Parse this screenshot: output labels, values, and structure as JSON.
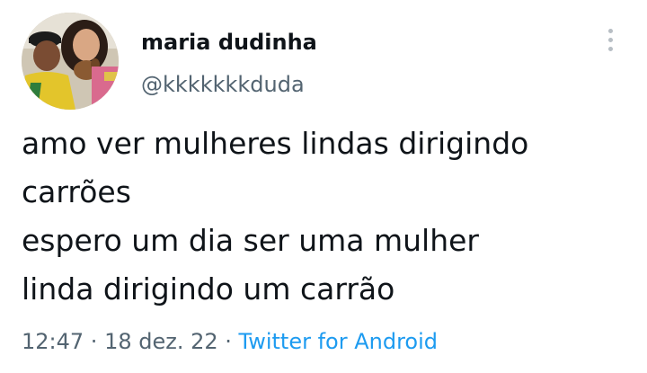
{
  "user": {
    "display_name": "maria dudinha",
    "handle": "@kkkkkkkduda",
    "avatar_icon": "profile-photo"
  },
  "tweet": {
    "lines": [
      "amo ver mulheres lindas dirigindo",
      "carrões",
      "espero um dia ser uma mulher",
      "linda dirigindo um carrão"
    ]
  },
  "meta": {
    "time": "12:47",
    "sep1": " · ",
    "date": "18 dez. 22",
    "sep2": " · ",
    "source": "Twitter for Android"
  },
  "icons": {
    "more": "vertical-ellipsis-icon"
  },
  "colors": {
    "text": "#0f1419",
    "secondary": "#536471",
    "link": "#1d9bf0",
    "icon": "#b7bec4"
  }
}
